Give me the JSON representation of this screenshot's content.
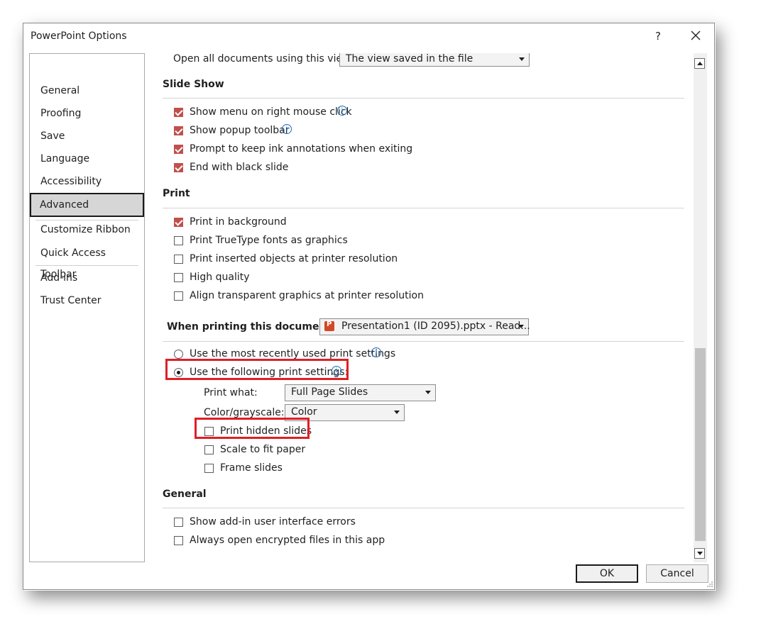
{
  "window": {
    "title": "PowerPoint Options",
    "help_label": "?",
    "close_label": "✕"
  },
  "nav": {
    "items": [
      {
        "label": "General"
      },
      {
        "label": "Proofing"
      },
      {
        "label": "Save"
      },
      {
        "label": "Language"
      },
      {
        "label": "Accessibility"
      },
      {
        "label": "Advanced",
        "active": true
      },
      {
        "label": "Customize Ribbon"
      },
      {
        "label": "Quick Access Toolbar"
      },
      {
        "label": "Add-ins"
      },
      {
        "label": "Trust Center"
      }
    ]
  },
  "display": {
    "open_view_label": "Open all documents using this view",
    "open_view_value": "The view saved in the file"
  },
  "slideshow": {
    "title": "Slide Show",
    "options": [
      {
        "label": "Show menu on right mouse click",
        "checked": true,
        "info": true
      },
      {
        "label": "Show popup toolbar",
        "checked": true,
        "info": true
      },
      {
        "label": "Prompt to keep ink annotations when exiting",
        "checked": true
      },
      {
        "label": "End with black slide",
        "checked": true
      }
    ]
  },
  "print": {
    "title": "Print",
    "options": [
      {
        "label": "Print in background",
        "checked": true
      },
      {
        "label": "Print TrueType fonts as graphics",
        "checked": false
      },
      {
        "label": "Print inserted objects at printer resolution",
        "checked": false
      },
      {
        "label": "High quality",
        "checked": false
      },
      {
        "label": "Align transparent graphics at printer resolution",
        "checked": false
      }
    ]
  },
  "when_printing": {
    "label": "When printing this document:",
    "document_value": "Presentation1 (ID 2095).pptx  -  Read...",
    "radio_recent": "Use the most recently used print settings",
    "radio_following": "Use the following print settings:",
    "print_what_label": "Print what:",
    "print_what_value": "Full Page Slides",
    "color_label": "Color/grayscale:",
    "color_value": "Color",
    "options": [
      {
        "label": "Print hidden slides",
        "checked": false
      },
      {
        "label": "Scale to fit paper",
        "checked": false
      },
      {
        "label": "Frame slides",
        "checked": false
      }
    ]
  },
  "general": {
    "title": "General",
    "options": [
      {
        "label": "Show add-in user interface errors",
        "checked": false
      },
      {
        "label": "Always open encrypted files in this app",
        "checked": false
      }
    ]
  },
  "footer": {
    "ok_label": "OK",
    "cancel_label": "Cancel"
  },
  "colors": {
    "checkbox_checked": "#c0504d",
    "highlight": "#e01f26",
    "info": "#1f6fbf"
  },
  "icons": [
    "help-icon",
    "close-icon",
    "info-icon",
    "powerpoint-file-icon",
    "chevron-down-icon",
    "scroll-up-icon",
    "scroll-down-icon",
    "resize-grip-icon"
  ]
}
